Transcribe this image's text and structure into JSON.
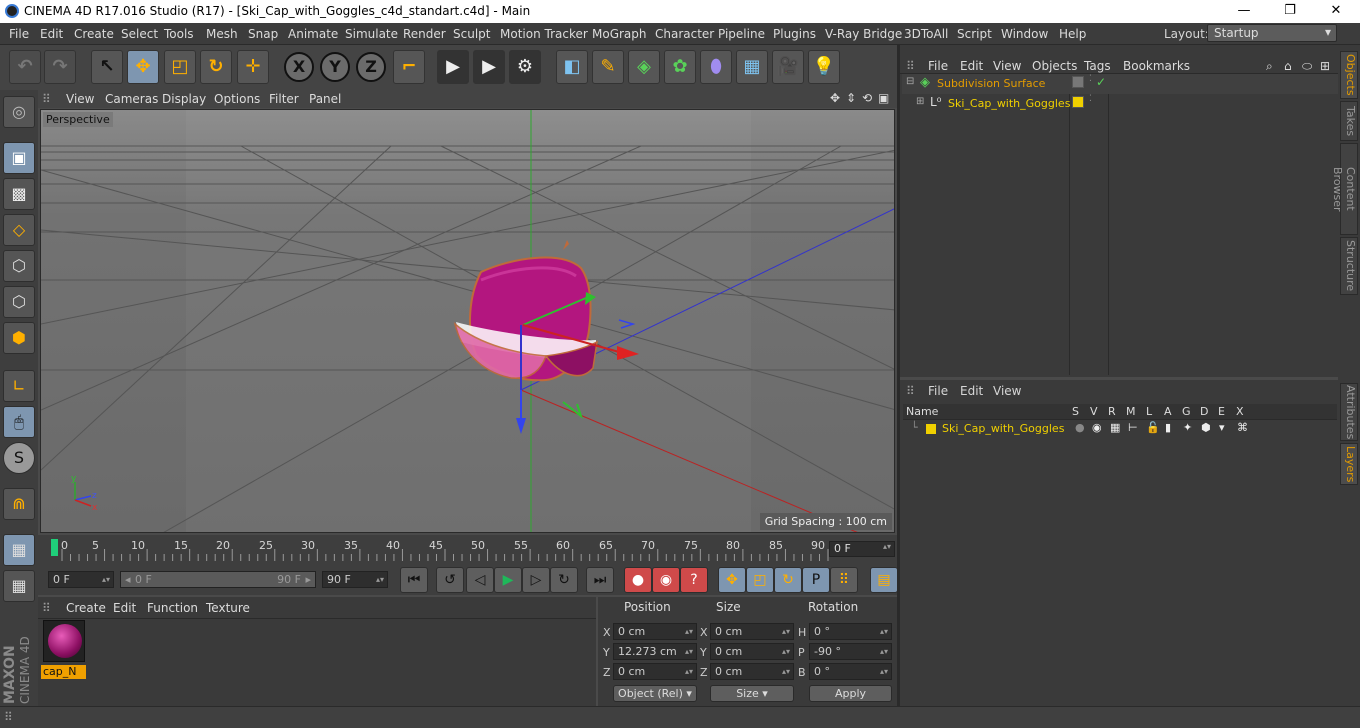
{
  "window": {
    "title": "CINEMA 4D R17.016 Studio (R17) - [Ski_Cap_with_Goggles_c4d_standart.c4d] - Main",
    "min": "—",
    "max": "❐",
    "close": "✕"
  },
  "menu": [
    "File",
    "Edit",
    "Create",
    "Select",
    "Tools",
    "Mesh",
    "Snap",
    "Animate",
    "Simulate",
    "Render",
    "Sculpt",
    "Motion Tracker",
    "MoGraph",
    "Character",
    "Pipeline",
    "Plugins",
    "V-Ray Bridge",
    "3DToAll",
    "Script",
    "Window",
    "Help"
  ],
  "layout": {
    "label": "Layout:",
    "value": "Startup"
  },
  "viewport": {
    "menu": [
      "View",
      "Cameras",
      "Display",
      "Options",
      "Filter",
      "Panel"
    ],
    "label": "Perspective",
    "grid_spacing": "Grid Spacing : 100 cm"
  },
  "timeline": {
    "ticks": [
      "0",
      "5",
      "10",
      "15",
      "20",
      "25",
      "30",
      "35",
      "40",
      "45",
      "50",
      "55",
      "60",
      "65",
      "70",
      "75",
      "80",
      "85",
      "90"
    ],
    "current_frame": "0 F",
    "start": "0 F",
    "range_start": "0 F",
    "range_end": "90 F",
    "end": "90 F"
  },
  "material": {
    "menu": [
      "Create",
      "Edit",
      "Function",
      "Texture"
    ],
    "name": "cap_N",
    "color": "#b3167f"
  },
  "coords": {
    "headers": [
      "Position",
      "Size",
      "Rotation"
    ],
    "rows": [
      {
        "axis": "X",
        "pos": "0 cm",
        "size_axis": "X",
        "size": "0 cm",
        "rot_axis": "H",
        "rot": "0 °"
      },
      {
        "axis": "Y",
        "pos": "12.273 cm",
        "size_axis": "Y",
        "size": "0 cm",
        "rot_axis": "P",
        "rot": "-90 °"
      },
      {
        "axis": "Z",
        "pos": "0 cm",
        "size_axis": "Z",
        "size": "0 cm",
        "rot_axis": "B",
        "rot": "0 °"
      }
    ],
    "mode": "Object (Rel)",
    "size_mode": "Size",
    "apply": "Apply"
  },
  "objects": {
    "menu": [
      "File",
      "Edit",
      "View",
      "Objects",
      "Tags",
      "Bookmarks"
    ],
    "items": [
      {
        "name": "Subdivision Surface",
        "color": "#e49c00"
      },
      {
        "name": "Ski_Cap_with_Goggles",
        "color": "#f0d000"
      }
    ]
  },
  "layers": {
    "menu": [
      "File",
      "Edit",
      "View"
    ],
    "columns": [
      "Name",
      "S",
      "V",
      "R",
      "M",
      "L",
      "A",
      "G",
      "D",
      "E",
      "X"
    ],
    "items": [
      {
        "name": "Ski_Cap_with_Goggles",
        "color": "#f0d000"
      }
    ]
  },
  "right_tabs": [
    "Objects",
    "Takes",
    "Content Browser",
    "Structure",
    "Attributes",
    "Layers"
  ],
  "brand": {
    "line1": "MAXON",
    "line2": "CINEMA 4D"
  }
}
